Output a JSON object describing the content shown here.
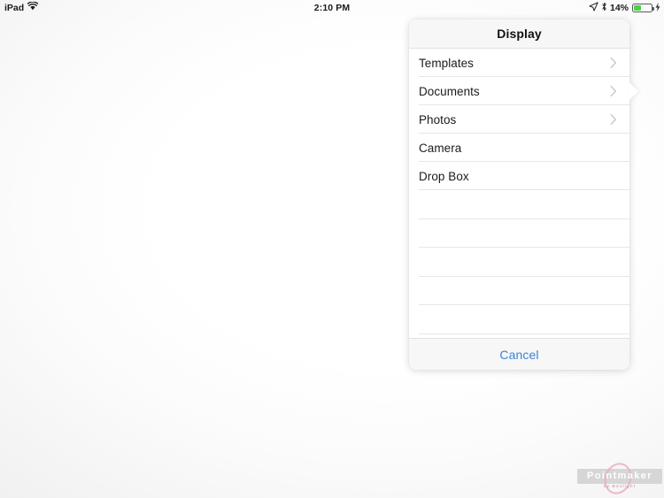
{
  "status_bar": {
    "device": "iPad",
    "wifi_icon": "wifi-icon",
    "time": "2:10 PM",
    "location_icon": "location-arrow-icon",
    "bluetooth_icon": "bluetooth-icon",
    "battery_percent": "14%",
    "battery_icon": "battery-icon",
    "charging_icon": "charging-bolt-icon",
    "battery_fill_color": "#4cd048"
  },
  "popover": {
    "title": "Display",
    "items": [
      {
        "label": "Templates",
        "chevron": true
      },
      {
        "label": "Documents",
        "chevron": true
      },
      {
        "label": "Photos",
        "chevron": true
      },
      {
        "label": "Camera",
        "chevron": false
      },
      {
        "label": "Drop Box",
        "chevron": false
      }
    ],
    "empty_row_count": 5,
    "cancel_label": "Cancel",
    "accent_color": "#3b82d6"
  },
  "watermark": {
    "brand": "Pointmaker",
    "tagline": "by Boxlight",
    "band_color": "#d4d4d4",
    "loop_color": "#e8a8bd"
  }
}
